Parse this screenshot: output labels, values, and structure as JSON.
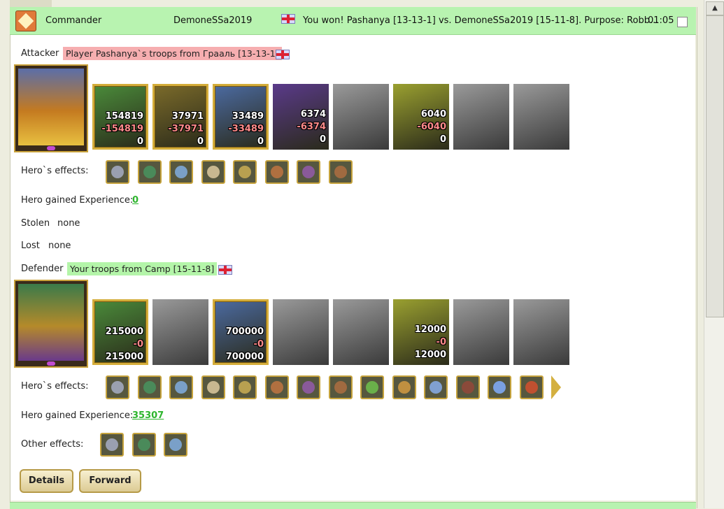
{
  "header": {
    "role": "Commander",
    "player": "DemoneSSa2019",
    "message": "You won! Pashanya [13-13-1] vs. DemoneSSa2019 [15-11-8]. Purpose: Robb...",
    "time": "01:05",
    "color": "#b8f3b0"
  },
  "attacker": {
    "label": "Attacker",
    "troops": "Player Pashanya`s troops from Грааль [13-13-1]",
    "effects_label": "Hero`s effects:",
    "exp_label": "Hero gained Experience:",
    "exp_value": "0",
    "stolen_label": "Stolen",
    "stolen_value": "none",
    "lost_label": "Lost",
    "lost_value": "none",
    "units": [
      {
        "start": "154819",
        "lost": "-154819",
        "left": "0",
        "gold": true
      },
      {
        "start": "37971",
        "lost": "-37971",
        "left": "0",
        "gold": true
      },
      {
        "start": "33489",
        "lost": "-33489",
        "left": "0",
        "gold": true
      },
      {
        "start": "6374",
        "lost": "-6374",
        "left": "0",
        "gold": false
      },
      {
        "start": "",
        "lost": "",
        "left": "",
        "gold": false
      },
      {
        "start": "6040",
        "lost": "-6040",
        "left": "0",
        "gold": false
      },
      {
        "start": "",
        "lost": "",
        "left": "",
        "gold": false
      },
      {
        "start": "",
        "lost": "",
        "left": "",
        "gold": false
      }
    ],
    "effect_icons": [
      "amulet-icon",
      "armor-icon",
      "ring-icon",
      "scroll-icon",
      "staff-icon",
      "shield-icon",
      "sword-icon",
      "bow-icon"
    ]
  },
  "defender": {
    "label": "Defender",
    "troops": "Your troops from Camp [15-11-8]",
    "effects_label": "Hero`s effects:",
    "exp_label": "Hero gained Experience:",
    "exp_value": "35307",
    "other_label": "Other effects:",
    "units": [
      {
        "start": "215000",
        "lost": "-0",
        "left": "215000",
        "gold": true
      },
      {
        "start": "",
        "lost": "",
        "left": "",
        "gold": false
      },
      {
        "start": "700000",
        "lost": "-0",
        "left": "700000",
        "gold": true
      },
      {
        "start": "",
        "lost": "",
        "left": "",
        "gold": false
      },
      {
        "start": "",
        "lost": "",
        "left": "",
        "gold": false
      },
      {
        "start": "12000",
        "lost": "-0",
        "left": "12000",
        "gold": false
      },
      {
        "start": "",
        "lost": "",
        "left": "",
        "gold": false
      },
      {
        "start": "",
        "lost": "",
        "left": "",
        "gold": false
      }
    ],
    "effect_icons": [
      "sword-icon",
      "handshake-icon",
      "hand-icon",
      "dice-icon",
      "shield-icon",
      "handshield-icon",
      "armor-icon",
      "amulet-icon",
      "chest-icon",
      "ring-icon",
      "scroll-icon",
      "club-icon",
      "crystal-icon",
      "xp-badge-icon",
      "next-arrow-icon"
    ],
    "other_icons": [
      "xp-icon",
      "castle-icon",
      "fist-icon"
    ]
  },
  "buttons": {
    "details": "Details",
    "forward": "Forward"
  }
}
